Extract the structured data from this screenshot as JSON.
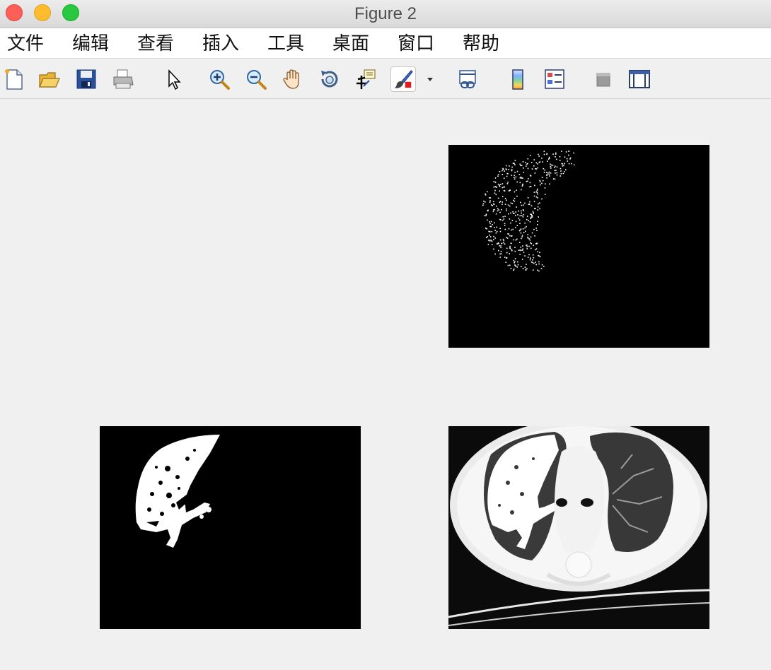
{
  "window": {
    "title": "Figure 2"
  },
  "menu": {
    "items": [
      {
        "label": "文件"
      },
      {
        "label": "编辑"
      },
      {
        "label": "查看"
      },
      {
        "label": "插入"
      },
      {
        "label": "工具"
      },
      {
        "label": "桌面"
      },
      {
        "label": "窗口"
      },
      {
        "label": "帮助"
      }
    ]
  },
  "toolbar": {
    "tools": [
      {
        "icon": "new-figure-icon"
      },
      {
        "icon": "open-file-icon"
      },
      {
        "icon": "save-icon"
      },
      {
        "icon": "print-icon"
      },
      {
        "icon": "pointer-icon"
      },
      {
        "icon": "zoom-in-icon"
      },
      {
        "icon": "zoom-out-icon"
      },
      {
        "icon": "pan-hand-icon"
      },
      {
        "icon": "rotate-3d-icon"
      },
      {
        "icon": "data-cursor-icon"
      },
      {
        "icon": "brush-icon"
      },
      {
        "icon": "dropdown-arrow-icon"
      },
      {
        "icon": "link-plot-icon"
      },
      {
        "icon": "colorbar-icon"
      },
      {
        "icon": "legend-icon"
      },
      {
        "icon": "hide-plot-tools-icon"
      },
      {
        "icon": "show-plot-tools-icon"
      }
    ]
  },
  "figure": {
    "subplots": [
      {
        "position": "top-left",
        "content": "empty"
      },
      {
        "position": "top-right",
        "content": "lung-edge-binary-image"
      },
      {
        "position": "bottom-left",
        "content": "lung-mask-binary-image"
      },
      {
        "position": "bottom-right",
        "content": "ct-scan-with-overlay-image"
      }
    ]
  },
  "colors": {
    "axes_background": "#000000",
    "figure_background": "#f0f0f0"
  }
}
